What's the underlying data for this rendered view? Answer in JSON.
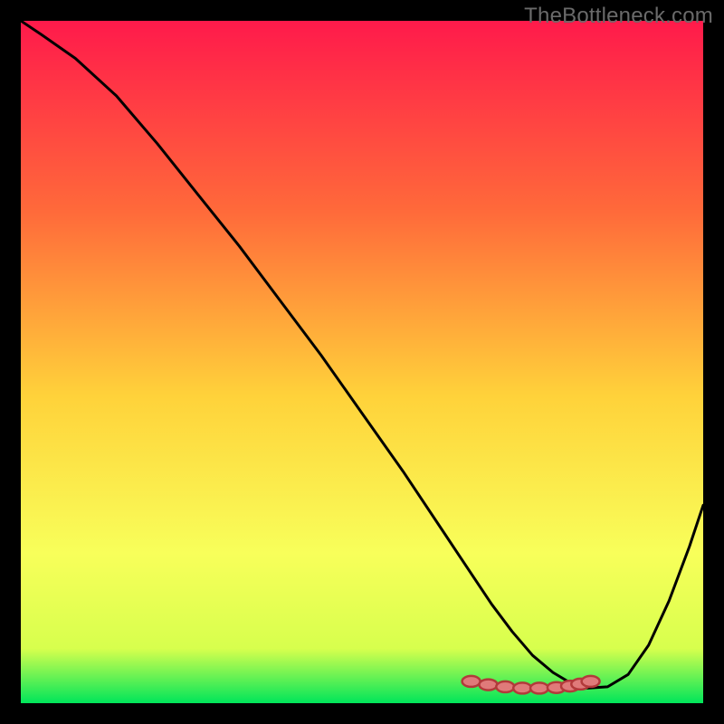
{
  "watermark": "TheBottleneck.com",
  "colors": {
    "bg_black": "#000000",
    "grad_top": "#ff1a4b",
    "grad_mid_upper": "#ff6a3a",
    "grad_mid": "#ffd23a",
    "grad_lower": "#f8ff5a",
    "grad_bottom_upper": "#d7ff4d",
    "grad_bottom": "#00e55a",
    "curve": "#000000",
    "marker_outline": "#b23a3a",
    "marker_fill": "#e07a7a"
  },
  "chart_data": {
    "type": "line",
    "title": "",
    "xlabel": "",
    "ylabel": "",
    "xlim": [
      0,
      100
    ],
    "ylim": [
      0,
      100
    ],
    "series": [
      {
        "name": "bottleneck-curve",
        "x": [
          0,
          3,
          8,
          14,
          20,
          26,
          32,
          38,
          44,
          50,
          56,
          62,
          66,
          69,
          72,
          75,
          78,
          80.5,
          83,
          86,
          89,
          92,
          95,
          98,
          100
        ],
        "y": [
          100,
          98,
          94.5,
          89,
          82,
          74.5,
          67,
          59,
          51,
          42.5,
          34,
          25,
          19,
          14.5,
          10.5,
          7,
          4.5,
          3,
          2.2,
          2.4,
          4.2,
          8.5,
          15,
          23,
          29
        ]
      }
    ],
    "markers": {
      "name": "highlight-segment",
      "x": [
        66,
        68.5,
        71,
        73.5,
        76,
        78.5,
        80.5,
        82,
        83.5
      ],
      "y": [
        3.2,
        2.7,
        2.4,
        2.2,
        2.2,
        2.3,
        2.5,
        2.8,
        3.2
      ]
    }
  }
}
